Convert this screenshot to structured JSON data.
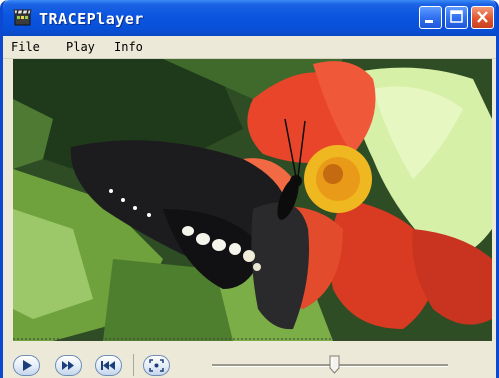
{
  "window": {
    "title": "TRACEPlayer",
    "app_icon": "film-clapper-icon",
    "controls": [
      "minimize-icon",
      "maximize-icon",
      "close-icon"
    ]
  },
  "menu": {
    "items": [
      {
        "label": "File"
      },
      {
        "label": "Play"
      },
      {
        "label": "Info"
      }
    ]
  },
  "video": {
    "content": "butterfly on red flower",
    "colors": {
      "petal": "#e8452a",
      "butterfly": "#1c1c1e",
      "leaf": "#6a9a3a",
      "center": "#f0b820"
    }
  },
  "controls": {
    "buttons": [
      {
        "name": "play-button",
        "icon": "play-icon"
      },
      {
        "name": "fast-forward-button",
        "icon": "fast-forward-icon"
      },
      {
        "name": "rewind-button",
        "icon": "rewind-icon"
      },
      {
        "name": "fullscreen-button",
        "icon": "fullscreen-icon"
      }
    ],
    "seek_position": 0.52
  },
  "colors": {
    "titlebar": "#0b55e0",
    "window_border": "#0a49d0",
    "close_button": "#e0552d",
    "chrome": "#ece9d8"
  }
}
